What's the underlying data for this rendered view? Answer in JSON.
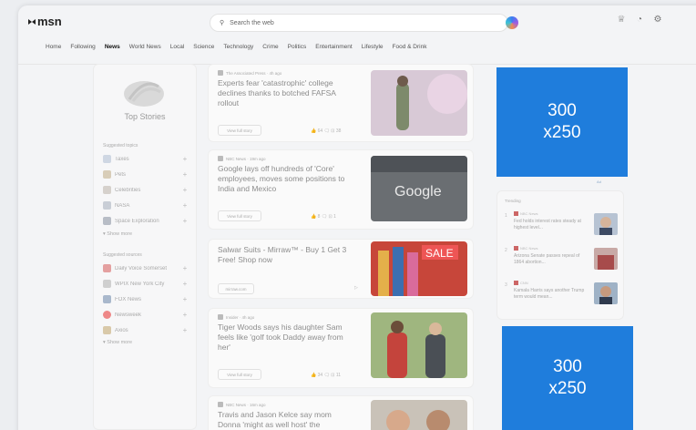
{
  "header": {
    "logo_text": "msn",
    "search_placeholder": "Search the web"
  },
  "nav": [
    "Home",
    "Following",
    "News",
    "World News",
    "Local",
    "Science",
    "Technology",
    "Crime",
    "Politics",
    "Entertainment",
    "Lifestyle",
    "Food & Drink"
  ],
  "nav_active": "News",
  "sidebar": {
    "hero_title": "Top Stories",
    "suggested_topics_title": "Suggested topics",
    "topics": [
      "Taxes",
      "Pets",
      "Celebrities",
      "NASA",
      "Space Exploration"
    ],
    "suggested_sources_title": "Suggested sources",
    "sources": [
      "Daily Voice Somerset",
      "WPIX New York City",
      "FOX News",
      "Newsweek",
      "Axios"
    ],
    "show_more": "Show more"
  },
  "cards": [
    {
      "source": "The Associated Press · 4h ago",
      "headline": "Experts fear 'catastrophic' college declines thanks to botched FAFSA rollout",
      "button": "View full story",
      "reactions": "👍 64   🗨   ⊡ 38"
    },
    {
      "source": "NBC News · 19m ago",
      "headline": "Google lays off hundreds of 'Core' employees, moves some positions to India and Mexico",
      "button": "View full story",
      "reactions": "👍 8   🗨   ⊡ 1"
    },
    {
      "source": "",
      "headline": "Salwar Suits - Mirraw™ - Buy 1 Get 3 Free! Shop now",
      "button": "mirraw.com",
      "reactions": ""
    },
    {
      "source": "Insider · 4h ago",
      "headline": "Tiger Woods says his daughter Sam feels like 'golf took Daddy away from her'",
      "button": "View full story",
      "reactions": "👍 34   🗨   ⊡ 11"
    },
    {
      "source": "NBC News · 16m ago",
      "headline": "Travis and Jason Kelce say mom Donna 'might as well host' the",
      "button": "",
      "reactions": ""
    }
  ],
  "ads": [
    {
      "line1": "300",
      "line2": "x250"
    },
    {
      "line1": "300",
      "line2": "x250"
    }
  ],
  "ad_label": "Ad",
  "trending": {
    "title": "Trending",
    "items": [
      {
        "num": "1",
        "source": "NBC News",
        "text": "Fed holds interest rates steady at highest level..."
      },
      {
        "num": "2",
        "source": "NBC News",
        "text": "Arizona Senate passes repeal of 1864 abortion..."
      },
      {
        "num": "3",
        "source": "CNN",
        "text": "Kamala Harris says another Trump term would mean..."
      }
    ]
  },
  "colors": {
    "ad_blue": "#1f7ddc",
    "background": "#eceef1"
  }
}
